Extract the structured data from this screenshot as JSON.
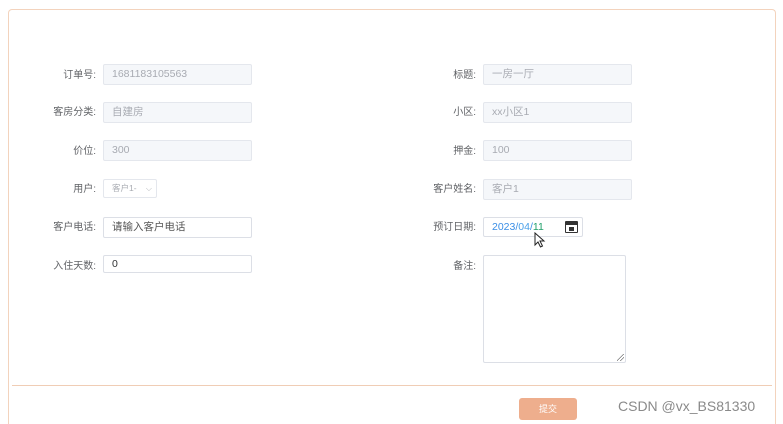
{
  "form": {
    "order_no": {
      "label": "订单号:",
      "value": "1681183105563"
    },
    "title": {
      "label": "标题:",
      "value": "一房一厅"
    },
    "room_category": {
      "label": "客房分类:",
      "value": "自建房"
    },
    "community": {
      "label": "小区:",
      "value": "xx小区1"
    },
    "price": {
      "label": "价位:",
      "value": "300"
    },
    "deposit": {
      "label": "押金:",
      "value": "100"
    },
    "user": {
      "label": "用户:",
      "selected": "客户1-"
    },
    "customer_name": {
      "label": "客户姓名:",
      "value": "客户1"
    },
    "customer_phone": {
      "label": "客户电话:",
      "placeholder": "请输入客户电话"
    },
    "booking_date": {
      "label": "预订日期:",
      "year": "2023",
      "sep": "/",
      "month": "04",
      "day": "11"
    },
    "stay_days": {
      "label": "入住天数:",
      "value": "0"
    },
    "remark": {
      "label": "备注:"
    }
  },
  "actions": {
    "submit_label": "提交"
  },
  "watermark": "CSDN @vx_BS81330",
  "icons": {
    "select_chevron": "chevron-down-icon",
    "calendar": "calendar-icon",
    "cursor": "mouse-pointer-icon"
  },
  "colors": {
    "border_accent": "#f3d3bd",
    "submit_bg": "#eeae8d",
    "date_year": "#3a8ee6",
    "date_day": "#22a06b"
  }
}
